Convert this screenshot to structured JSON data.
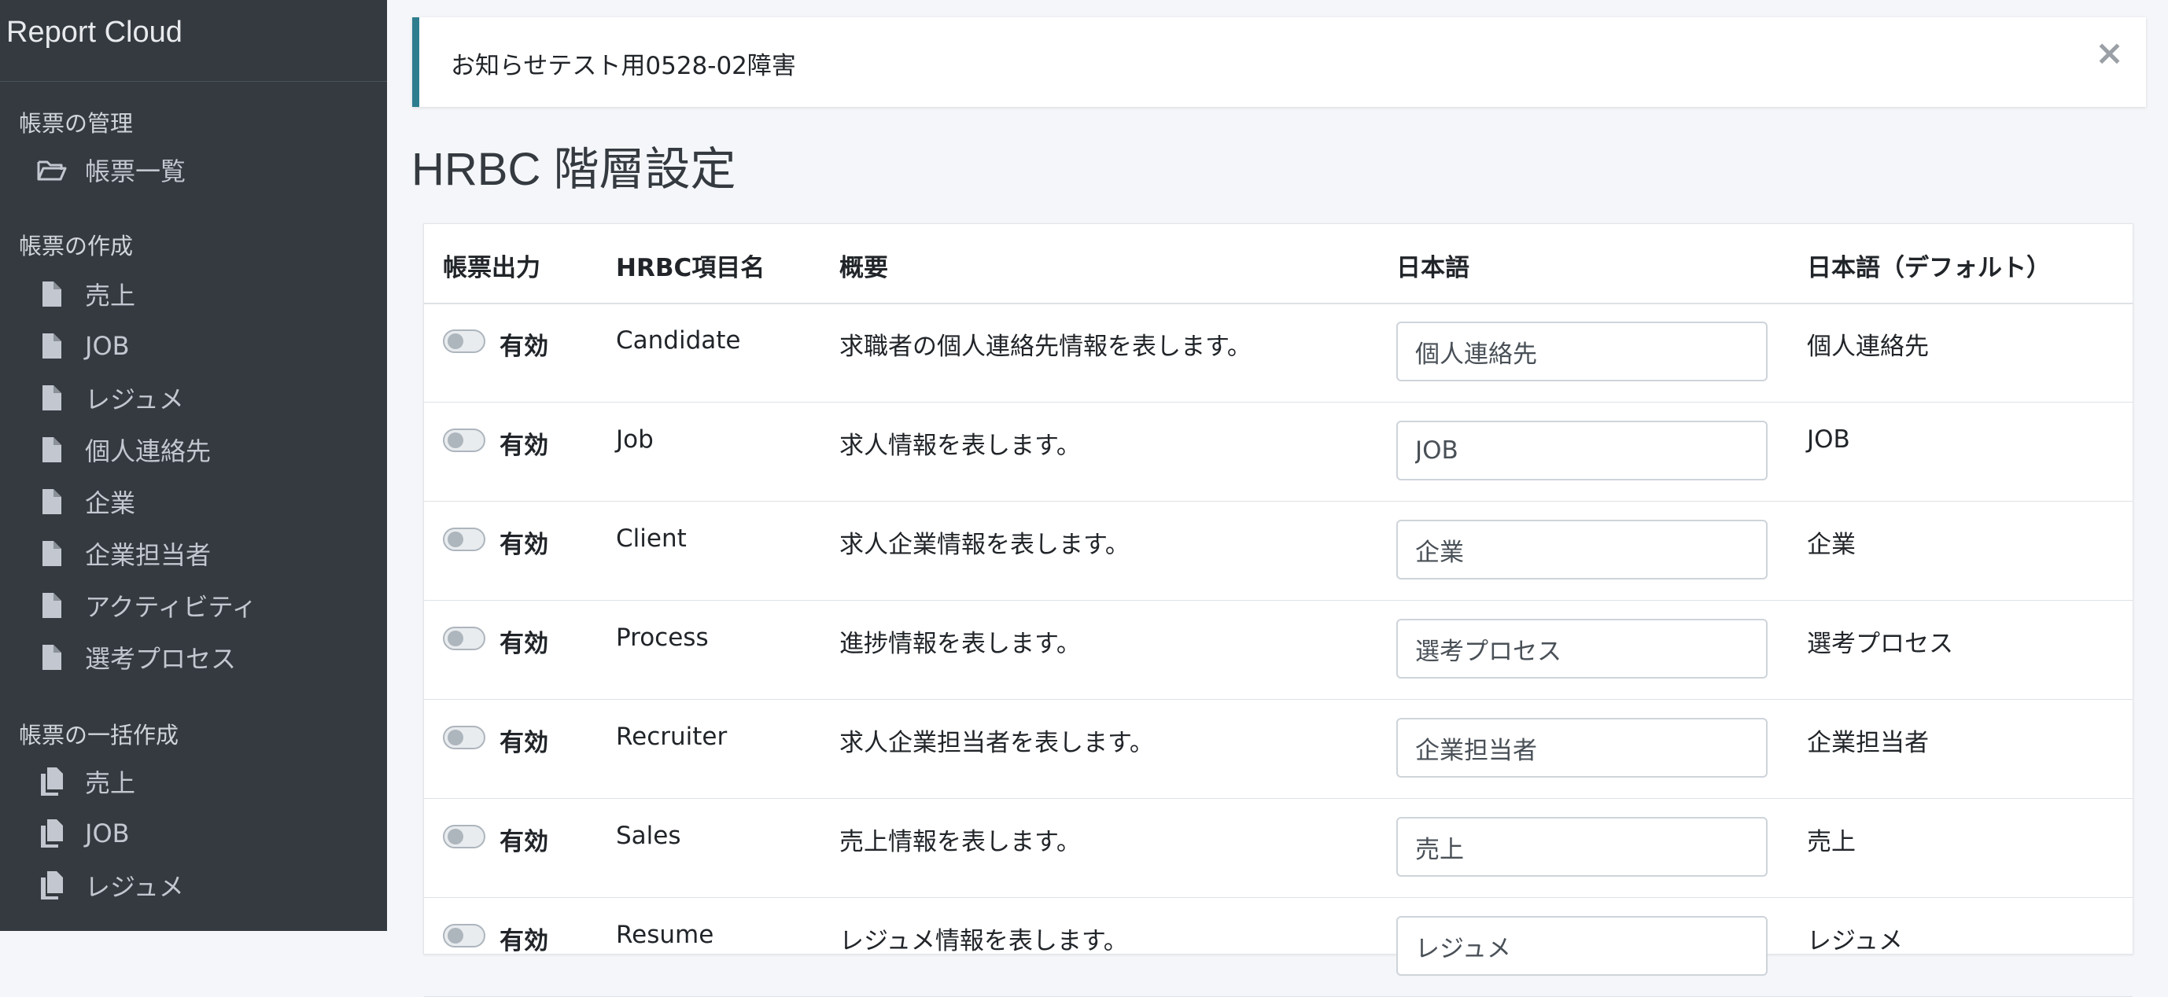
{
  "app": {
    "title": "Report Cloud"
  },
  "sidebar": {
    "sections": [
      {
        "header": "帳票の管理",
        "items": [
          {
            "label": "帳票一覧",
            "icon": "folder-open-icon"
          }
        ]
      },
      {
        "header": "帳票の作成",
        "items": [
          {
            "label": "売上",
            "icon": "file-icon"
          },
          {
            "label": "JOB",
            "icon": "file-icon"
          },
          {
            "label": "レジュメ",
            "icon": "file-icon"
          },
          {
            "label": "個人連絡先",
            "icon": "file-icon"
          },
          {
            "label": "企業",
            "icon": "file-icon"
          },
          {
            "label": "企業担当者",
            "icon": "file-icon"
          },
          {
            "label": "アクティビティ",
            "icon": "file-icon"
          },
          {
            "label": "選考プロセス",
            "icon": "file-icon"
          }
        ]
      },
      {
        "header": "帳票の一括作成",
        "items": [
          {
            "label": "売上",
            "icon": "copy-icon"
          },
          {
            "label": "JOB",
            "icon": "copy-icon"
          },
          {
            "label": "レジュメ",
            "icon": "copy-icon"
          }
        ]
      }
    ]
  },
  "alert": {
    "text": "お知らせテスト用0528-02障害",
    "close": "×"
  },
  "page": {
    "title": "HRBC 階層設定"
  },
  "table": {
    "headers": [
      "帳票出力",
      "HRBC項目名",
      "概要",
      "日本語",
      "日本語（デフォルト）"
    ],
    "rows": [
      {
        "enabled": "有効",
        "name": "Candidate",
        "desc": "求職者の個人連絡先情報を表します。",
        "ja": "個人連絡先",
        "default": "個人連絡先"
      },
      {
        "enabled": "有効",
        "name": "Job",
        "desc": "求人情報を表します。",
        "ja": "JOB",
        "default": "JOB"
      },
      {
        "enabled": "有効",
        "name": "Client",
        "desc": "求人企業情報を表します。",
        "ja": "企業",
        "default": "企業"
      },
      {
        "enabled": "有効",
        "name": "Process",
        "desc": "進捗情報を表します。",
        "ja": "選考プロセス",
        "default": "選考プロセス"
      },
      {
        "enabled": "有効",
        "name": "Recruiter",
        "desc": "求人企業担当者を表します。",
        "ja": "企業担当者",
        "default": "企業担当者"
      },
      {
        "enabled": "有効",
        "name": "Sales",
        "desc": "売上情報を表します。",
        "ja": "売上",
        "default": "売上"
      },
      {
        "enabled": "有効",
        "name": "Resume",
        "desc": "レジュメ情報を表します。",
        "ja": "レジュメ",
        "default": "レジュメ"
      }
    ]
  },
  "colors": {
    "sidebar_bg": "#343a40",
    "alert_accent": "#2e7d8e",
    "page_bg": "#f4f6f9"
  }
}
